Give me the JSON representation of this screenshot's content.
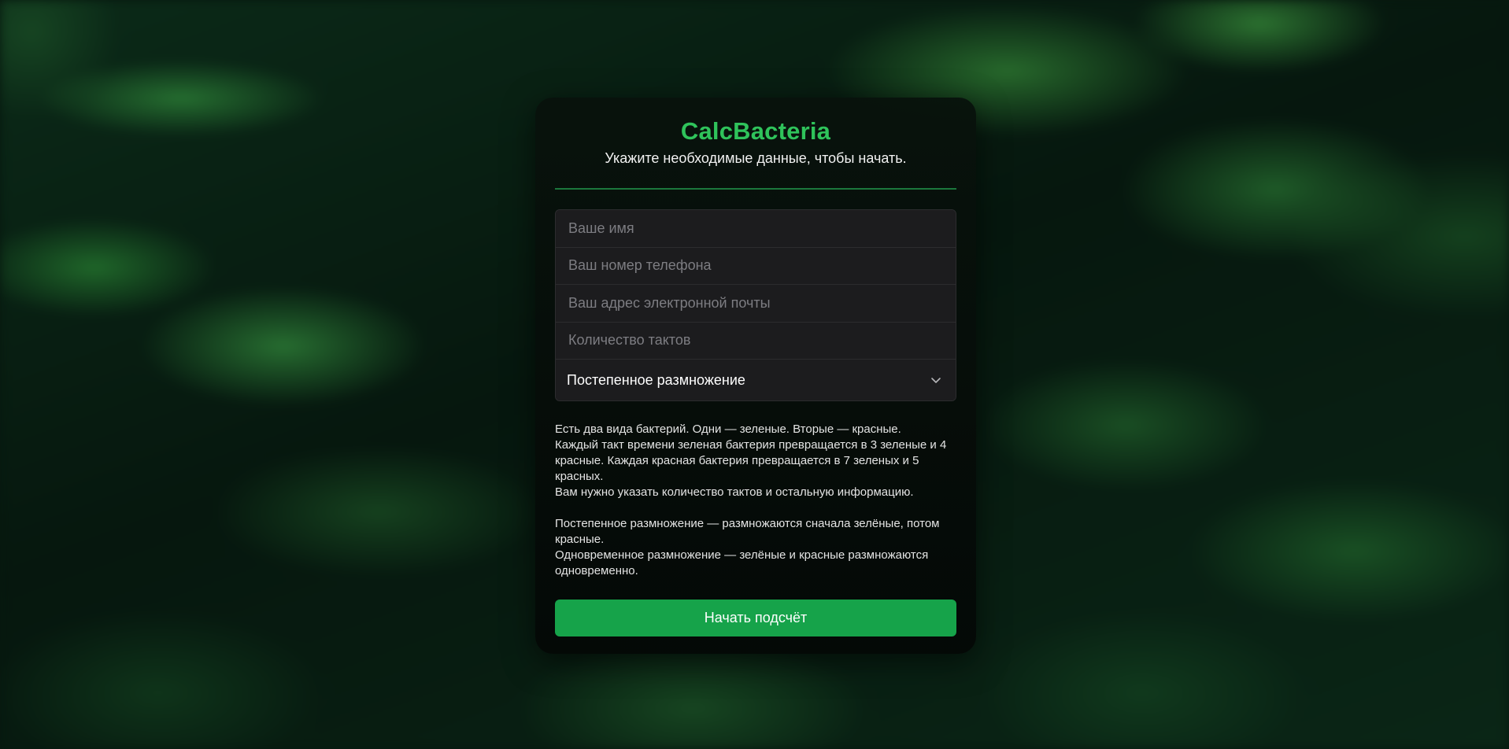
{
  "app": {
    "title": "CalcBacteria",
    "subtitle": "Укажите необходимые данные, чтобы начать."
  },
  "form": {
    "name_placeholder": "Ваше имя",
    "phone_placeholder": "Ваш номер телефона",
    "email_placeholder": "Ваш адрес электронной почты",
    "ticks_placeholder": "Количество тактов",
    "mode_select": {
      "selected": "Постепенное размножение",
      "icon": "chevron-down-icon"
    }
  },
  "description": {
    "p1": "Есть два вида бактерий. Одни — зеленые. Вторые — красные.",
    "p2": "Каждый такт времени зеленая бактерия превращается в 3 зеленые и 4 красные. Каждая красная бактерия превращается в 7 зеленых и 5 красных.",
    "p3": "Вам нужно указать количество тактов и остальную информацию.",
    "p4": "Постепенное размножение — размножаются сначала зелёные, потом красные.",
    "p5": "Одновременное размножение — зелёные и красные размножаются одновременно."
  },
  "actions": {
    "start_label": "Начать подсчёт"
  },
  "colors": {
    "accent": "#2fc35b",
    "button": "#16a34a",
    "divider": "#1f8a45",
    "card_bg": "#060c08",
    "field_bg": "#1c1c1e"
  }
}
